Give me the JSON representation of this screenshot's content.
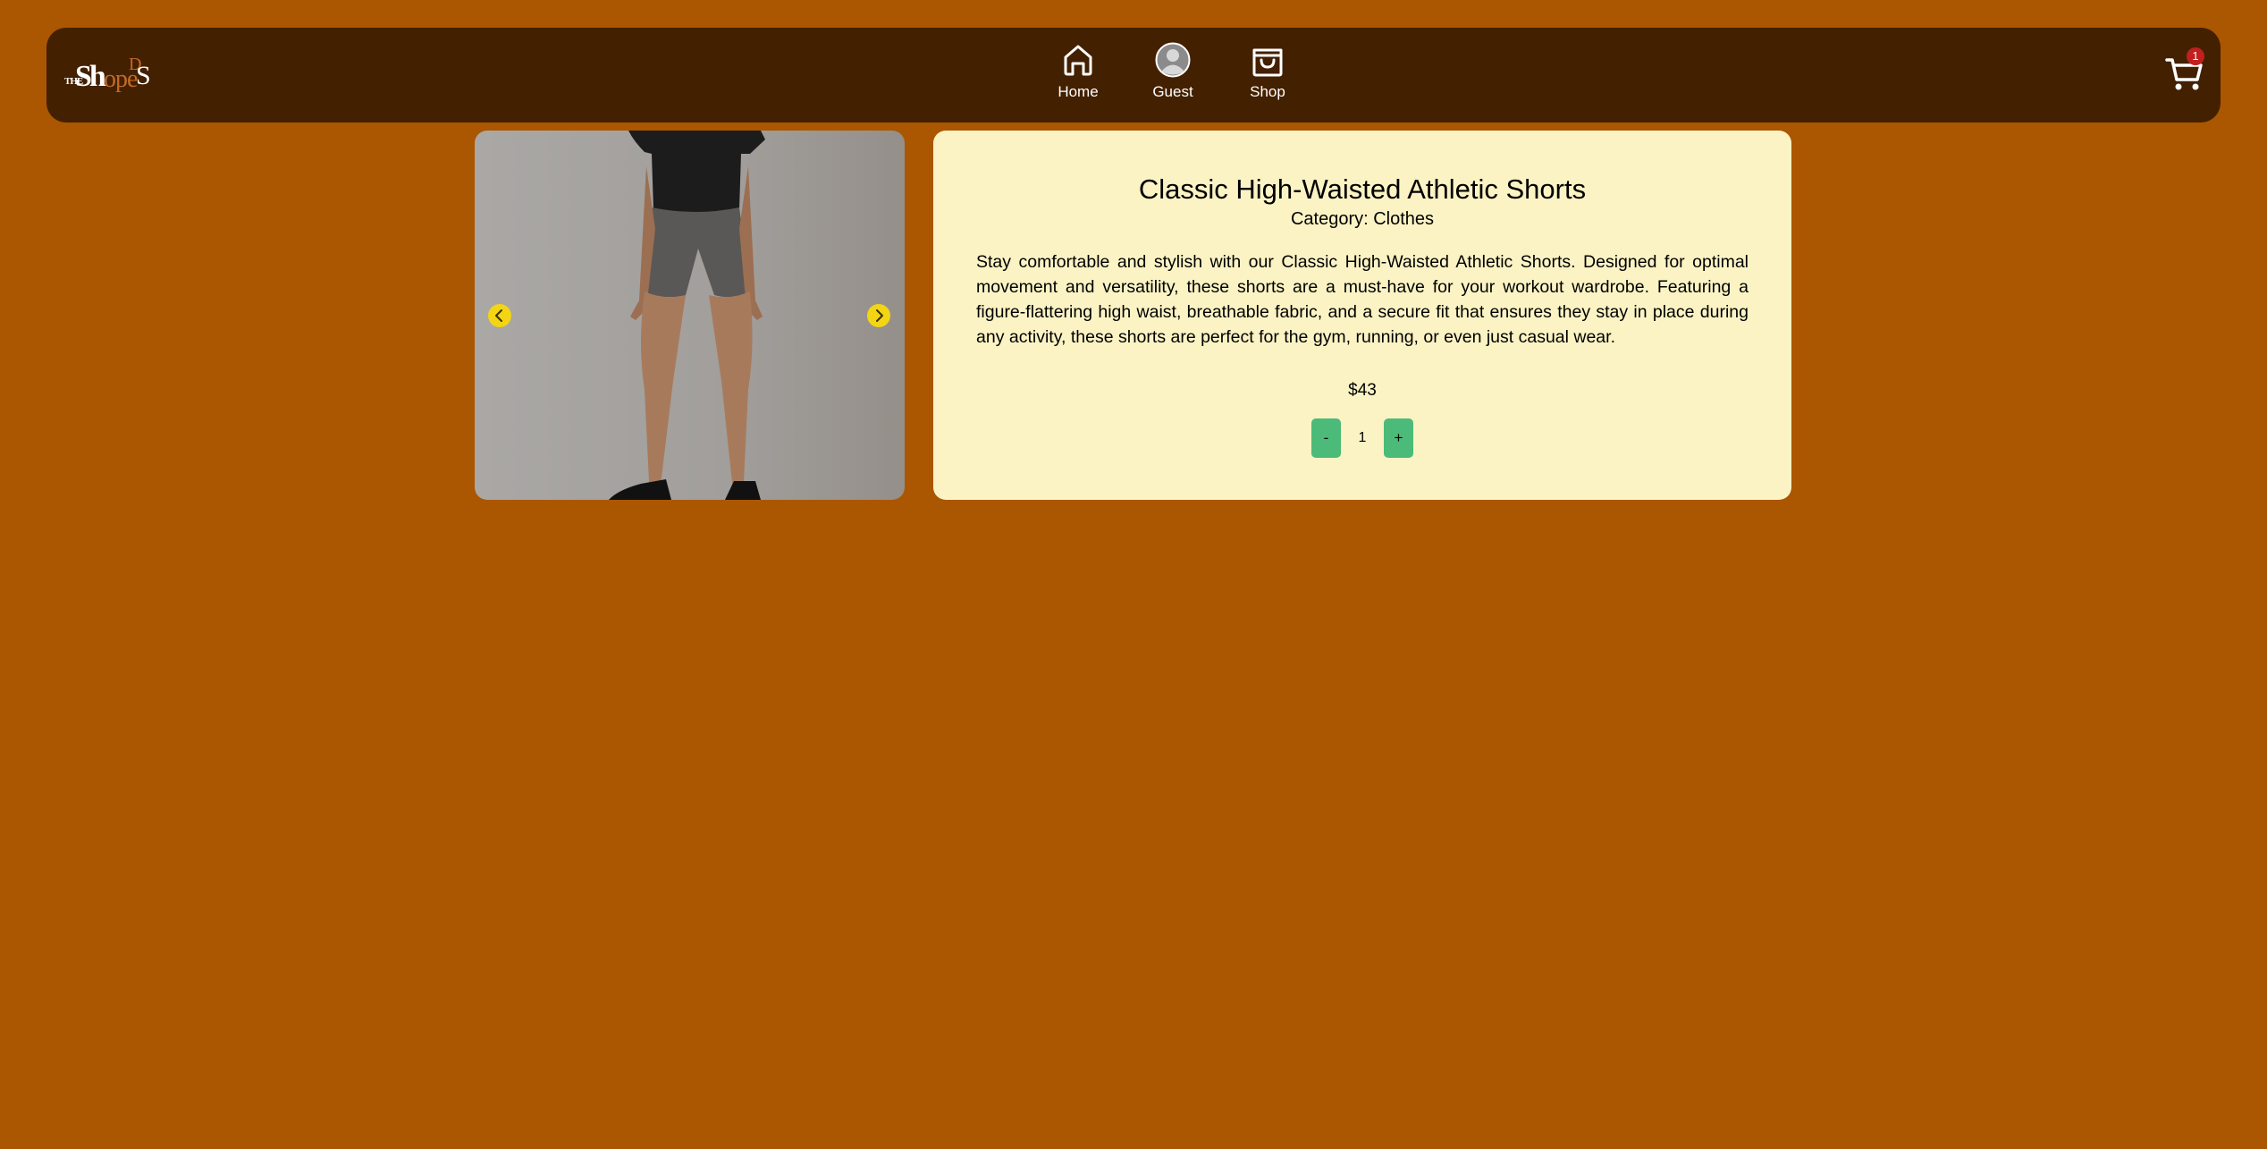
{
  "app": {
    "logo_text": "TheShopeDS"
  },
  "nav": {
    "items": [
      {
        "label": "Home",
        "icon": "home-icon"
      },
      {
        "label": "Guest",
        "icon": "user-avatar-icon"
      },
      {
        "label": "Shop",
        "icon": "shopping-bag-icon"
      }
    ],
    "cart": {
      "icon": "cart-icon",
      "badge": "1"
    }
  },
  "product": {
    "title": "Classic High-Waisted Athletic Shorts",
    "category": "Category: Clothes",
    "description": "Stay comfortable and stylish with our Classic High-Waisted Athletic Shorts. Designed for optimal movement and versatility, these shorts are a must-have for your workout wardrobe. Featuring a figure-flattering high waist, breathable fabric, and a secure fit that ensures they stay in place during any activity, these shorts are perfect for the gym, running, or even just casual wear.",
    "price": "$43",
    "quantity": {
      "minus_label": "-",
      "value": "1",
      "plus_label": "+"
    },
    "gallery": {
      "prev_icon": "chevron-left-icon",
      "next_icon": "chevron-right-icon"
    }
  },
  "colors": {
    "page_background": "#ab5600",
    "navbar": "#432000",
    "card": "#fbf3c4",
    "button_green": "#4cba78",
    "arrow_yellow": "#f3d514",
    "badge_red": "#c21f1f"
  }
}
